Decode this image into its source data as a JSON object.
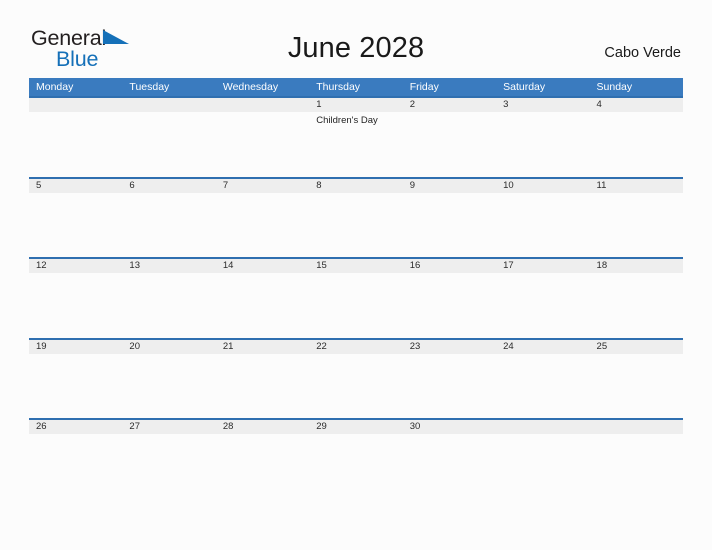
{
  "brand": {
    "word_one": "General",
    "word_two": "Blue",
    "flag_icon": "blue-flag-triangle-icon",
    "accent_color": "#1570b8"
  },
  "header": {
    "title": "June 2028",
    "country": "Cabo Verde"
  },
  "theme": {
    "header_blue": "#3a7bbf",
    "row_rule_blue": "#2f6fb0",
    "date_band_gray": "#eeeeee",
    "page_background": "#fcfcfc"
  },
  "calendar": {
    "weekdays": [
      "Monday",
      "Tuesday",
      "Wednesday",
      "Thursday",
      "Friday",
      "Saturday",
      "Sunday"
    ],
    "weeks": [
      {
        "days": [
          {
            "date": "",
            "event": ""
          },
          {
            "date": "",
            "event": ""
          },
          {
            "date": "",
            "event": ""
          },
          {
            "date": "1",
            "event": "Children's Day"
          },
          {
            "date": "2",
            "event": ""
          },
          {
            "date": "3",
            "event": ""
          },
          {
            "date": "4",
            "event": ""
          }
        ]
      },
      {
        "days": [
          {
            "date": "5",
            "event": ""
          },
          {
            "date": "6",
            "event": ""
          },
          {
            "date": "7",
            "event": ""
          },
          {
            "date": "8",
            "event": ""
          },
          {
            "date": "9",
            "event": ""
          },
          {
            "date": "10",
            "event": ""
          },
          {
            "date": "11",
            "event": ""
          }
        ]
      },
      {
        "days": [
          {
            "date": "12",
            "event": ""
          },
          {
            "date": "13",
            "event": ""
          },
          {
            "date": "14",
            "event": ""
          },
          {
            "date": "15",
            "event": ""
          },
          {
            "date": "16",
            "event": ""
          },
          {
            "date": "17",
            "event": ""
          },
          {
            "date": "18",
            "event": ""
          }
        ]
      },
      {
        "days": [
          {
            "date": "19",
            "event": ""
          },
          {
            "date": "20",
            "event": ""
          },
          {
            "date": "21",
            "event": ""
          },
          {
            "date": "22",
            "event": ""
          },
          {
            "date": "23",
            "event": ""
          },
          {
            "date": "24",
            "event": ""
          },
          {
            "date": "25",
            "event": ""
          }
        ]
      },
      {
        "days": [
          {
            "date": "26",
            "event": ""
          },
          {
            "date": "27",
            "event": ""
          },
          {
            "date": "28",
            "event": ""
          },
          {
            "date": "29",
            "event": ""
          },
          {
            "date": "30",
            "event": ""
          },
          {
            "date": "",
            "event": ""
          },
          {
            "date": "",
            "event": ""
          }
        ]
      }
    ]
  }
}
